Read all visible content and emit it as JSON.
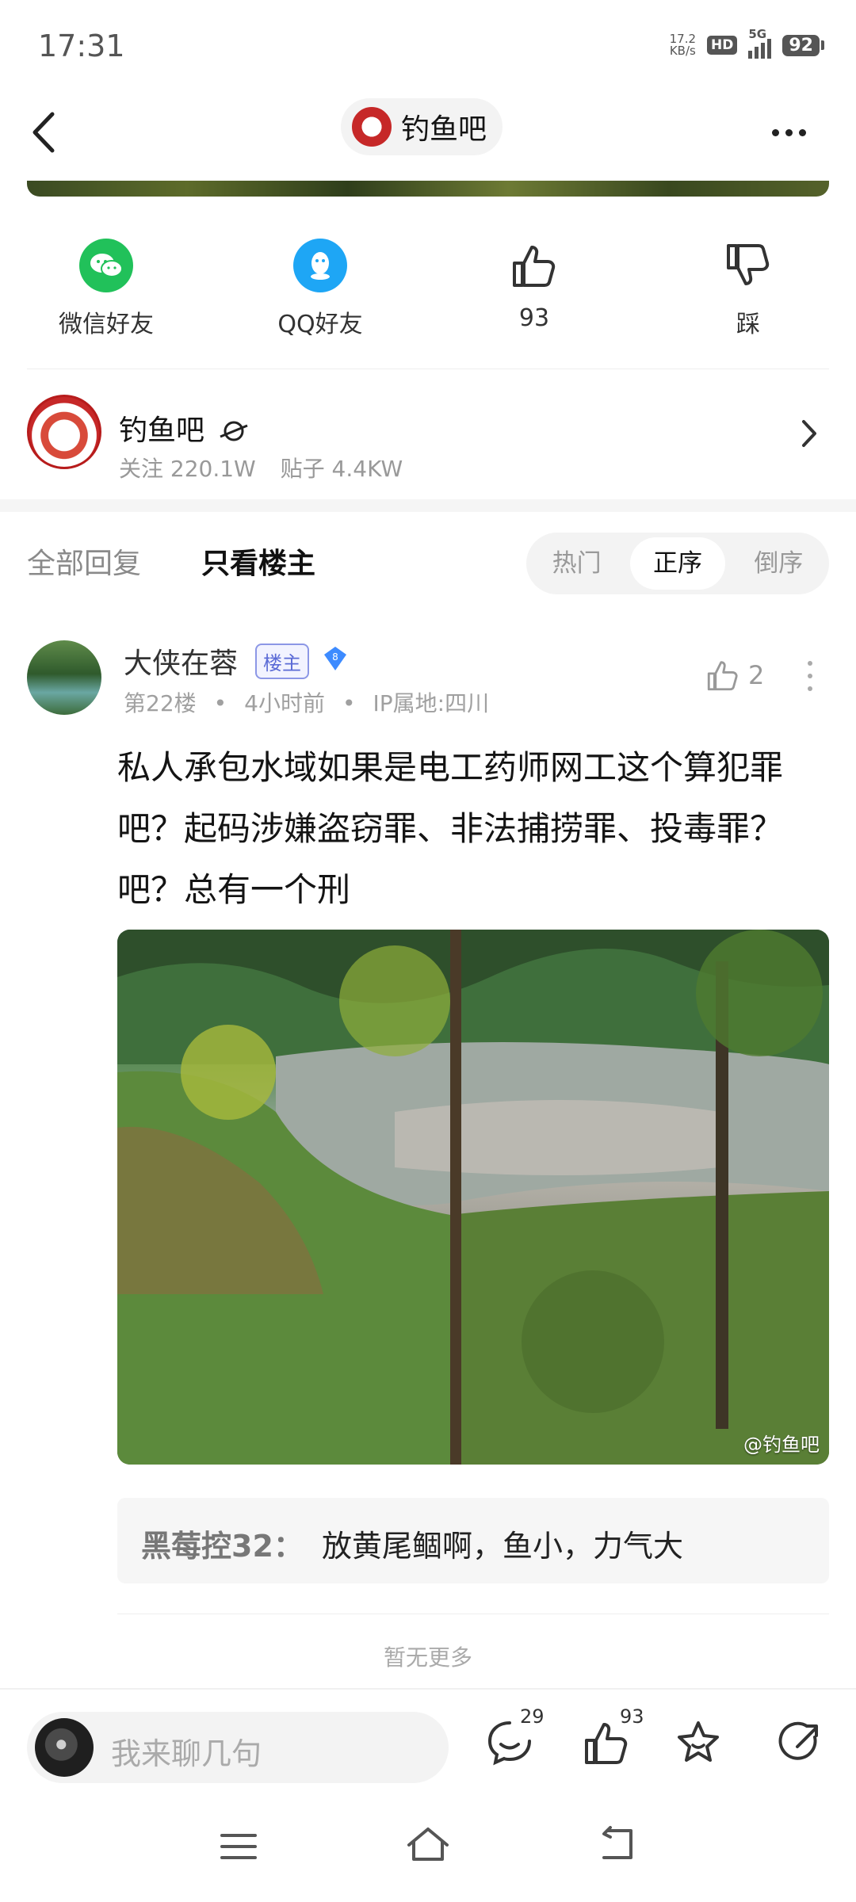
{
  "status_bar": {
    "time": "17:31",
    "net_speed_value": "17.2",
    "net_speed_unit": "KB/s",
    "hd": "HD",
    "network": "5G",
    "battery": "92"
  },
  "nav": {
    "forum_title": "钓鱼吧"
  },
  "share": {
    "wechat": "微信好友",
    "qq": "QQ好友",
    "like_count": "93",
    "dislike": "踩"
  },
  "forum_card": {
    "name": "钓鱼吧",
    "followers": "关注 220.1W",
    "posts": "贴子 4.4KW"
  },
  "tabs": {
    "all_replies": "全部回复",
    "author_only": "只看楼主",
    "sort": [
      "热门",
      "正序",
      "倒序"
    ],
    "active_sort": "正序"
  },
  "reply": {
    "username": "大侠在蓉",
    "author_badge": "楼主",
    "level": "8",
    "floor": "第22楼",
    "time": "4小时前",
    "ip": "IP属地:四川",
    "likes": "2",
    "text": "私人承包水域如果是电工药师网工这个算犯罪吧？起码涉嫌盗窃罪、非法捕捞罪、投毒罪？吧？总有一个刑",
    "image_watermark": "@钓鱼吧"
  },
  "sub_reply": {
    "author": "黑莓控32：",
    "text": "放黄尾鲴啊，鱼小，力气大"
  },
  "no_more": "暂无更多",
  "bottom_bar": {
    "input_placeholder": "我来聊几句",
    "comment_count": "29",
    "like_count": "93"
  },
  "colors": {
    "wechat_green": "#21c15a",
    "qq_blue": "#1ea6f5",
    "author_badge_purple": "#5b6bd6",
    "level_badge_blue": "#3d8bff"
  }
}
